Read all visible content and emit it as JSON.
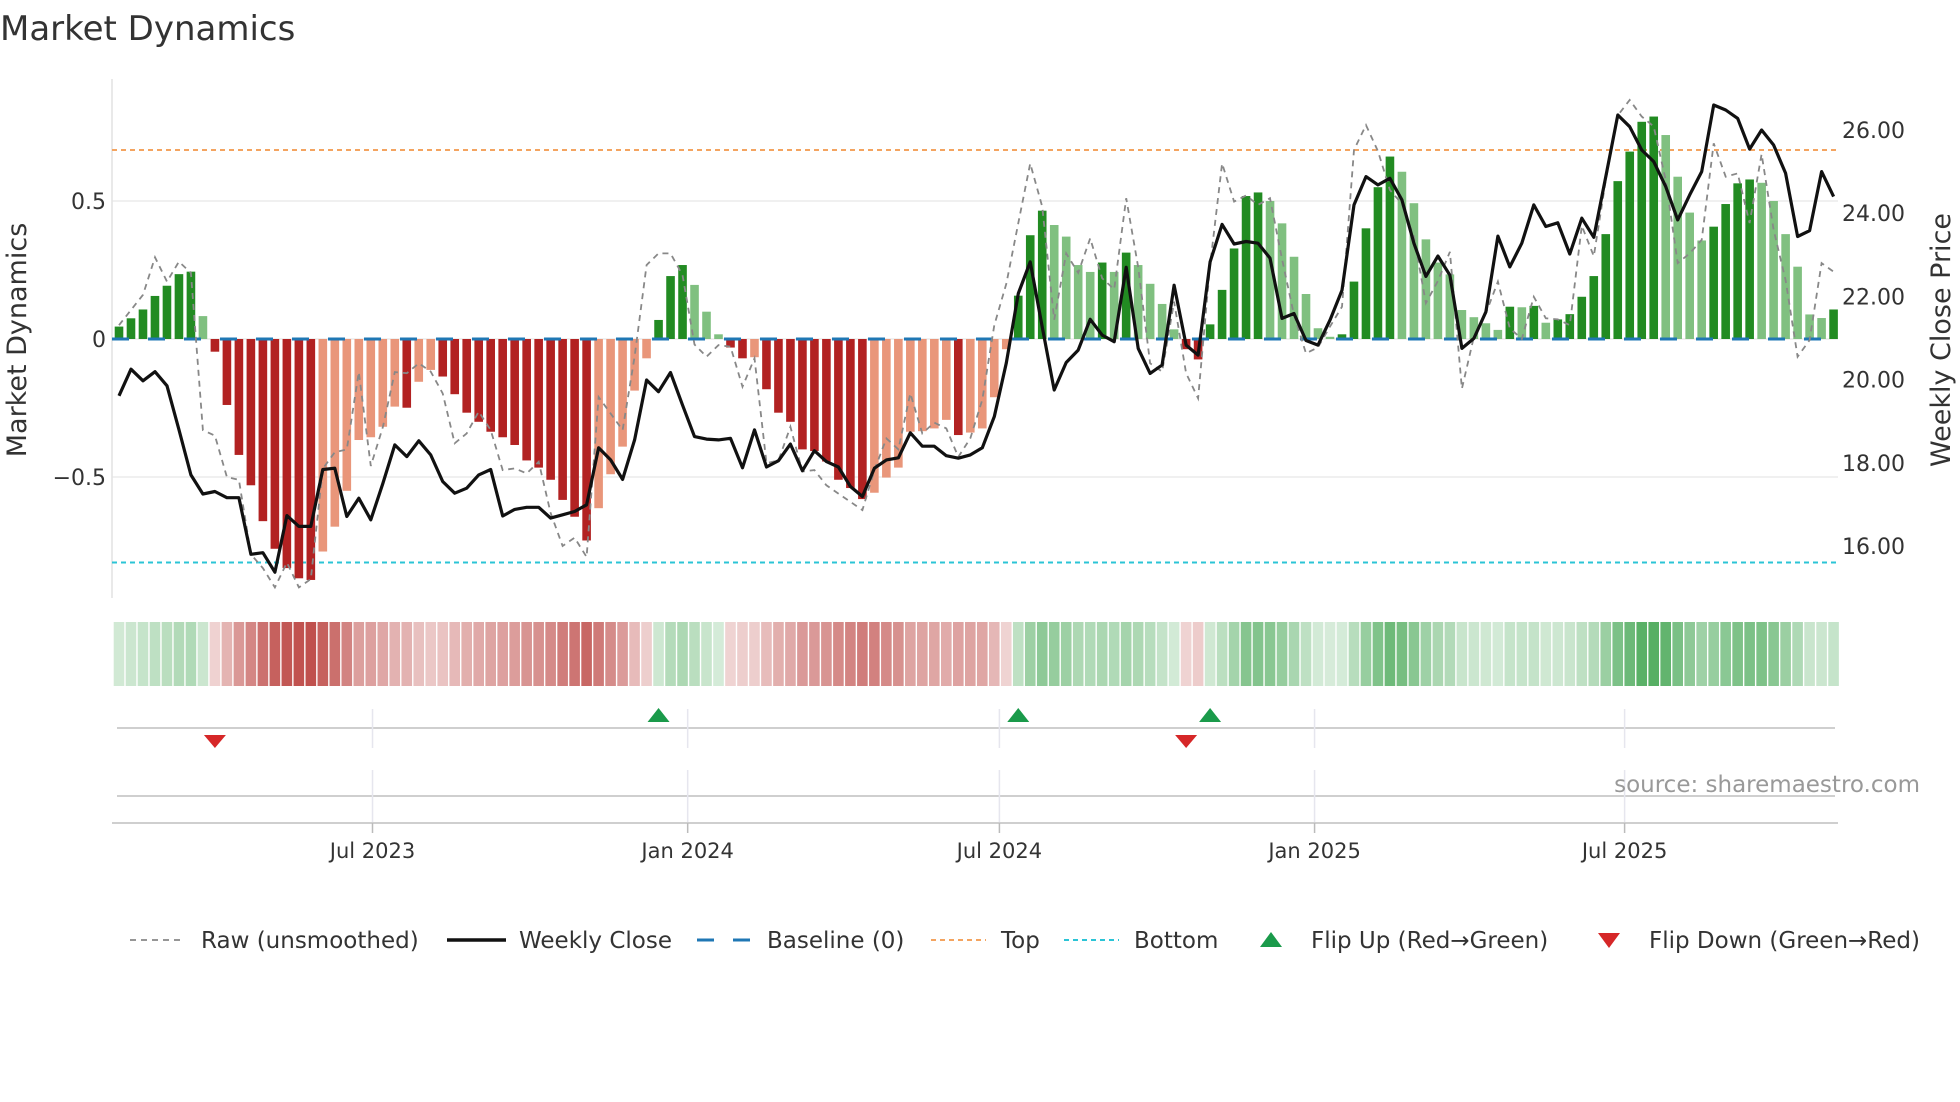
{
  "title": "Market Dynamics",
  "source": "source: sharemaestro.com",
  "chart_data": {
    "type": "bar",
    "title": "Market Dynamics",
    "x_start": "2023-02-03",
    "x_step_days": 7,
    "xlim": [
      -0.6,
      143.3
    ],
    "x_ticks": [
      {
        "date": "2023-07-01",
        "label": "Jul 2023"
      },
      {
        "date": "2024-01-01",
        "label": "Jan 2024"
      },
      {
        "date": "2024-07-01",
        "label": "Jul 2024"
      },
      {
        "date": "2025-01-01",
        "label": "Jan 2025"
      },
      {
        "date": "2025-07-01",
        "label": "Jul 2025"
      }
    ],
    "y_left": {
      "label": "Market Dynamics",
      "lim": [
        -0.94,
        0.94
      ],
      "ticks": [
        {
          "value": 0.5,
          "label": "0.5"
        },
        {
          "value": 0,
          "label": "0"
        },
        {
          "value": -0.5,
          "label": "−0.5"
        }
      ]
    },
    "y_right": {
      "label": "Weekly Close Price",
      "lim": [
        14.75,
        27.23
      ],
      "ticks": [
        {
          "value": 16,
          "label": "16.00"
        },
        {
          "value": 18,
          "label": "18.00"
        },
        {
          "value": 20,
          "label": "20.00"
        },
        {
          "value": 22,
          "label": "22.00"
        },
        {
          "value": 24,
          "label": "24.00"
        },
        {
          "value": 26,
          "label": "26.00"
        }
      ]
    },
    "levels": {
      "top": 0.685,
      "bottom": -0.81,
      "baseline": 0
    },
    "grid": "horizontal",
    "momentum": [
      0.045,
      0.075,
      0.107,
      0.156,
      0.193,
      0.235,
      0.244,
      0.083,
      -0.046,
      -0.239,
      -0.42,
      -0.53,
      -0.66,
      -0.76,
      -0.83,
      -0.867,
      -0.873,
      -0.77,
      -0.68,
      -0.55,
      -0.366,
      -0.356,
      -0.318,
      -0.245,
      -0.249,
      -0.155,
      -0.112,
      -0.136,
      -0.2,
      -0.267,
      -0.3,
      -0.336,
      -0.356,
      -0.384,
      -0.44,
      -0.466,
      -0.51,
      -0.583,
      -0.644,
      -0.73,
      -0.613,
      -0.49,
      -0.39,
      -0.187,
      -0.07,
      0.069,
      0.228,
      0.268,
      0.196,
      0.099,
      0.017,
      -0.031,
      -0.07,
      -0.066,
      -0.182,
      -0.267,
      -0.3,
      -0.4,
      -0.406,
      -0.444,
      -0.51,
      -0.54,
      -0.58,
      -0.557,
      -0.502,
      -0.466,
      -0.336,
      -0.334,
      -0.324,
      -0.293,
      -0.348,
      -0.339,
      -0.324,
      -0.211,
      -0.037,
      0.157,
      0.376,
      0.465,
      0.413,
      0.371,
      0.268,
      0.243,
      0.277,
      0.243,
      0.313,
      0.268,
      0.2,
      0.127,
      0.035,
      -0.037,
      -0.074,
      0.053,
      0.178,
      0.328,
      0.518,
      0.531,
      0.5,
      0.419,
      0.298,
      0.163,
      0.039,
      0.008,
      0.017,
      0.208,
      0.401,
      0.55,
      0.661,
      0.606,
      0.492,
      0.361,
      0.277,
      0.234,
      0.105,
      0.079,
      0.057,
      0.033,
      0.117,
      0.115,
      0.12,
      0.059,
      0.071,
      0.09,
      0.153,
      0.228,
      0.38,
      0.572,
      0.679,
      0.787,
      0.806,
      0.739,
      0.588,
      0.458,
      0.357,
      0.407,
      0.489,
      0.564,
      0.578,
      0.566,
      0.5,
      0.38,
      0.262,
      0.089,
      0.076,
      0.107
    ],
    "raw": [
      0.05,
      0.105,
      0.16,
      0.296,
      0.208,
      0.28,
      0.24,
      -0.33,
      -0.35,
      -0.5,
      -0.51,
      -0.78,
      -0.83,
      -0.9,
      -0.81,
      -0.9,
      -0.87,
      -0.47,
      -0.41,
      -0.4,
      -0.12,
      -0.46,
      -0.32,
      -0.12,
      -0.124,
      -0.088,
      -0.118,
      -0.197,
      -0.378,
      -0.342,
      -0.263,
      -0.33,
      -0.475,
      -0.469,
      -0.487,
      -0.445,
      -0.63,
      -0.75,
      -0.72,
      -0.79,
      -0.21,
      -0.27,
      -0.33,
      -0.064,
      0.268,
      0.31,
      0.31,
      0.232,
      -0.02,
      -0.064,
      -0.022,
      -0.028,
      -0.173,
      -0.07,
      -0.45,
      -0.44,
      -0.318,
      -0.48,
      -0.475,
      -0.53,
      -0.56,
      -0.59,
      -0.62,
      -0.475,
      -0.36,
      -0.4,
      -0.197,
      -0.342,
      -0.303,
      -0.324,
      -0.427,
      -0.36,
      -0.22,
      0.05,
      0.2,
      0.42,
      0.636,
      0.48,
      0.07,
      0.31,
      0.24,
      0.365,
      0.22,
      0.18,
      0.51,
      0.26,
      -0.088,
      -0.118,
      0.135,
      -0.124,
      -0.215,
      0.268,
      0.636,
      0.498,
      0.52,
      0.486,
      0.51,
      0.29,
      0.087,
      -0.052,
      -0.03,
      0.045,
      0.117,
      0.685,
      0.775,
      0.68,
      0.54,
      0.49,
      0.37,
      0.13,
      0.21,
      0.316,
      -0.18,
      0.008,
      0.093,
      0.208,
      0.039,
      0,
      0.153,
      0.075,
      0.071,
      0.05,
      0.41,
      0.3,
      0.576,
      0.81,
      0.866,
      0.806,
      0.77,
      0.576,
      0.275,
      0.31,
      0.359,
      0.709,
      0.588,
      0.6,
      0.42,
      0.67,
      0.396,
      0.213,
      -0.064,
      -0.004,
      0.275,
      0.244
    ],
    "close": [
      19.61,
      20.25,
      19.97,
      20.19,
      19.85,
      18.8,
      17.71,
      17.25,
      17.31,
      17.16,
      17.16,
      15.8,
      15.84,
      15.37,
      16.73,
      16.47,
      16.47,
      17.84,
      17.87,
      16.71,
      17.15,
      16.63,
      17.5,
      18.43,
      18.15,
      18.53,
      18.19,
      17.55,
      17.27,
      17.39,
      17.71,
      17.84,
      16.72,
      16.88,
      16.93,
      16.93,
      16.67,
      16.75,
      16.83,
      16.99,
      18.36,
      18.07,
      17.6,
      18.55,
      19.99,
      19.71,
      20.17,
      19.39,
      18.63,
      18.57,
      18.55,
      18.59,
      17.88,
      18.79,
      17.9,
      18.05,
      18.45,
      17.81,
      18.29,
      18.03,
      17.9,
      17.43,
      17.19,
      17.87,
      18.07,
      18.12,
      18.72,
      18.4,
      18.4,
      18.17,
      18.11,
      18.19,
      18.36,
      19.11,
      20.4,
      22.07,
      22.83,
      21.27,
      19.75,
      20.41,
      20.71,
      21.45,
      21.07,
      20.91,
      22.7,
      20.75,
      20.15,
      20.35,
      22.27,
      20.83,
      20.59,
      22.83,
      23.73,
      23.26,
      23.32,
      23.28,
      22.92,
      21.47,
      21.59,
      20.94,
      20.83,
      21.43,
      22.15,
      24.2,
      24.88,
      24.68,
      24.84,
      24.32,
      23.28,
      22.48,
      22.97,
      22.51,
      20.75,
      20.99,
      21.63,
      23.45,
      22.71,
      23.28,
      24.2,
      23.68,
      23.77,
      23.02,
      23.88,
      23.42,
      24.88,
      26.36,
      26.08,
      25.52,
      25.24,
      24.64,
      23.84,
      24.44,
      25.0,
      26.6,
      26.48,
      26.28,
      25.54,
      26.0,
      25.64,
      24.96,
      23.44,
      23.58,
      25.0,
      24.4
    ],
    "flips": [
      {
        "index": 8,
        "dir": "down"
      },
      {
        "index": 45,
        "dir": "up"
      },
      {
        "index": 75,
        "dir": "up"
      },
      {
        "index": 89,
        "dir": "down"
      },
      {
        "index": 91,
        "dir": "up"
      }
    ],
    "legend_position": "bottom",
    "legend": [
      {
        "key": "raw",
        "label": "Raw (unsmoothed)"
      },
      {
        "key": "close",
        "label": "Weekly Close"
      },
      {
        "key": "baseline",
        "label": "Baseline (0)"
      },
      {
        "key": "top",
        "label": "Top"
      },
      {
        "key": "bottom",
        "label": "Bottom"
      },
      {
        "key": "up",
        "label": "Flip Up (Red→Green)"
      },
      {
        "key": "down",
        "label": "Flip Down (Green→Red)"
      }
    ],
    "colors": {
      "green_dark": "#228b22",
      "green_light": "#80c080",
      "red_dark": "#b22222",
      "red_light": "#e9967a",
      "baseline": "#1f77b4",
      "top": "#f4a460",
      "bottom": "#2bc4d6",
      "raw": "#888888",
      "close": "#111111",
      "flip_up": "#1a9a4a",
      "flip_down": "#d62728",
      "strip_green": "76,170,90",
      "strip_red": "192,80,77"
    }
  }
}
